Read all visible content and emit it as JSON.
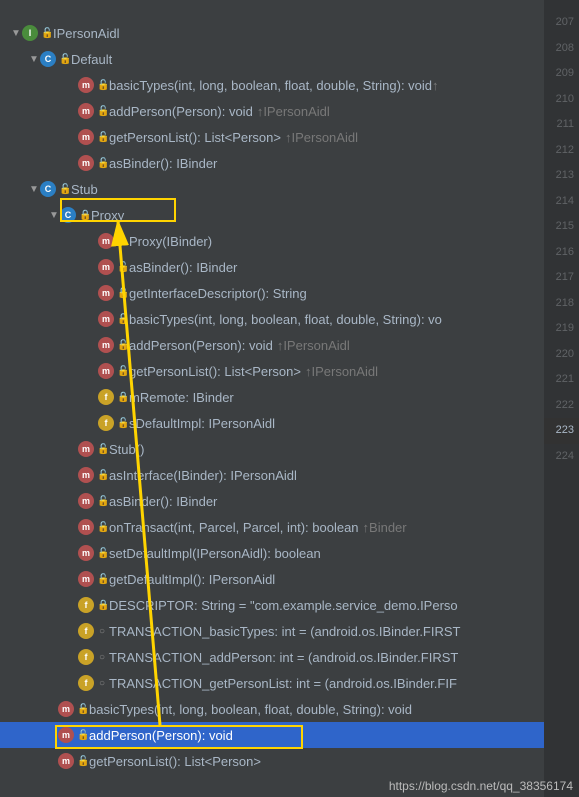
{
  "gutter": [
    "207",
    "208",
    "209",
    "210",
    "211",
    "212",
    "213",
    "214",
    "215",
    "216",
    "217",
    "218",
    "219",
    "220",
    "221",
    "222",
    "223",
    "224"
  ],
  "tree": {
    "iperson": {
      "label": "IPersonAidl",
      "icon": "I"
    },
    "default": {
      "label": "Default",
      "icon": "C"
    },
    "default_methods": [
      {
        "sig": "basicTypes(int, long, boolean, float, double, String): void",
        "impl": "↑"
      },
      {
        "sig": "addPerson(Person): void",
        "impl": "↑IPersonAidl"
      },
      {
        "sig": "getPersonList(): List<Person>",
        "impl": "↑IPersonAidl"
      },
      {
        "sig": "asBinder(): IBinder",
        "impl": ""
      }
    ],
    "stub": {
      "label": "Stub",
      "icon": "C"
    },
    "proxy": {
      "label": "Proxy",
      "icon": "C"
    },
    "proxy_members": [
      {
        "type": "m",
        "mod": "grey",
        "sig": "Proxy(IBinder)",
        "impl": ""
      },
      {
        "type": "m",
        "mod": "green",
        "sig": "asBinder(): IBinder",
        "impl": ""
      },
      {
        "type": "m",
        "mod": "green",
        "sig": "getInterfaceDescriptor(): String",
        "impl": ""
      },
      {
        "type": "m",
        "mod": "green",
        "sig": "basicTypes(int, long, boolean, float, double, String): vo",
        "impl": ""
      },
      {
        "type": "m",
        "mod": "green",
        "sig": "addPerson(Person): void",
        "impl": "↑IPersonAidl"
      },
      {
        "type": "m",
        "mod": "green",
        "sig": "getPersonList(): List<Person>",
        "impl": "↑IPersonAidl"
      },
      {
        "type": "f",
        "mod": "red",
        "sig": "mRemote: IBinder",
        "impl": ""
      },
      {
        "type": "f",
        "mod": "green",
        "sig": "sDefaultImpl: IPersonAidl",
        "impl": ""
      }
    ],
    "stub_members": [
      {
        "type": "m",
        "mod": "green",
        "sig": "Stub()",
        "impl": ""
      },
      {
        "type": "m",
        "mod": "green",
        "sig": "asInterface(IBinder): IPersonAidl",
        "impl": ""
      },
      {
        "type": "m",
        "mod": "green",
        "sig": "asBinder(): IBinder",
        "impl": ""
      },
      {
        "type": "m",
        "mod": "green",
        "sig": "onTransact(int, Parcel, Parcel, int): boolean",
        "impl": "↑Binder"
      },
      {
        "type": "m",
        "mod": "green",
        "sig": "setDefaultImpl(IPersonAidl): boolean",
        "impl": ""
      },
      {
        "type": "m",
        "mod": "green",
        "sig": "getDefaultImpl(): IPersonAidl",
        "impl": ""
      },
      {
        "type": "f",
        "mod": "red",
        "sig": "DESCRIPTOR: String = \"com.example.service_demo.IPerso",
        "impl": ""
      },
      {
        "type": "f",
        "mod": "grey",
        "sig": "TRANSACTION_basicTypes: int = (android.os.IBinder.FIRST",
        "impl": ""
      },
      {
        "type": "f",
        "mod": "grey",
        "sig": "TRANSACTION_addPerson: int = (android.os.IBinder.FIRST",
        "impl": ""
      },
      {
        "type": "f",
        "mod": "grey",
        "sig": "TRANSACTION_getPersonList: int = (android.os.IBinder.FIF",
        "impl": ""
      }
    ],
    "iperson_abstract": [
      {
        "sig": "basicTypes(int, long, boolean, float, double, String): void",
        "sel": false
      },
      {
        "sig": "addPerson(Person): void",
        "sel": true
      },
      {
        "sig": "getPersonList(): List<Person>",
        "sel": false
      }
    ]
  },
  "watermark": "https://blog.csdn.net/qq_38356174"
}
